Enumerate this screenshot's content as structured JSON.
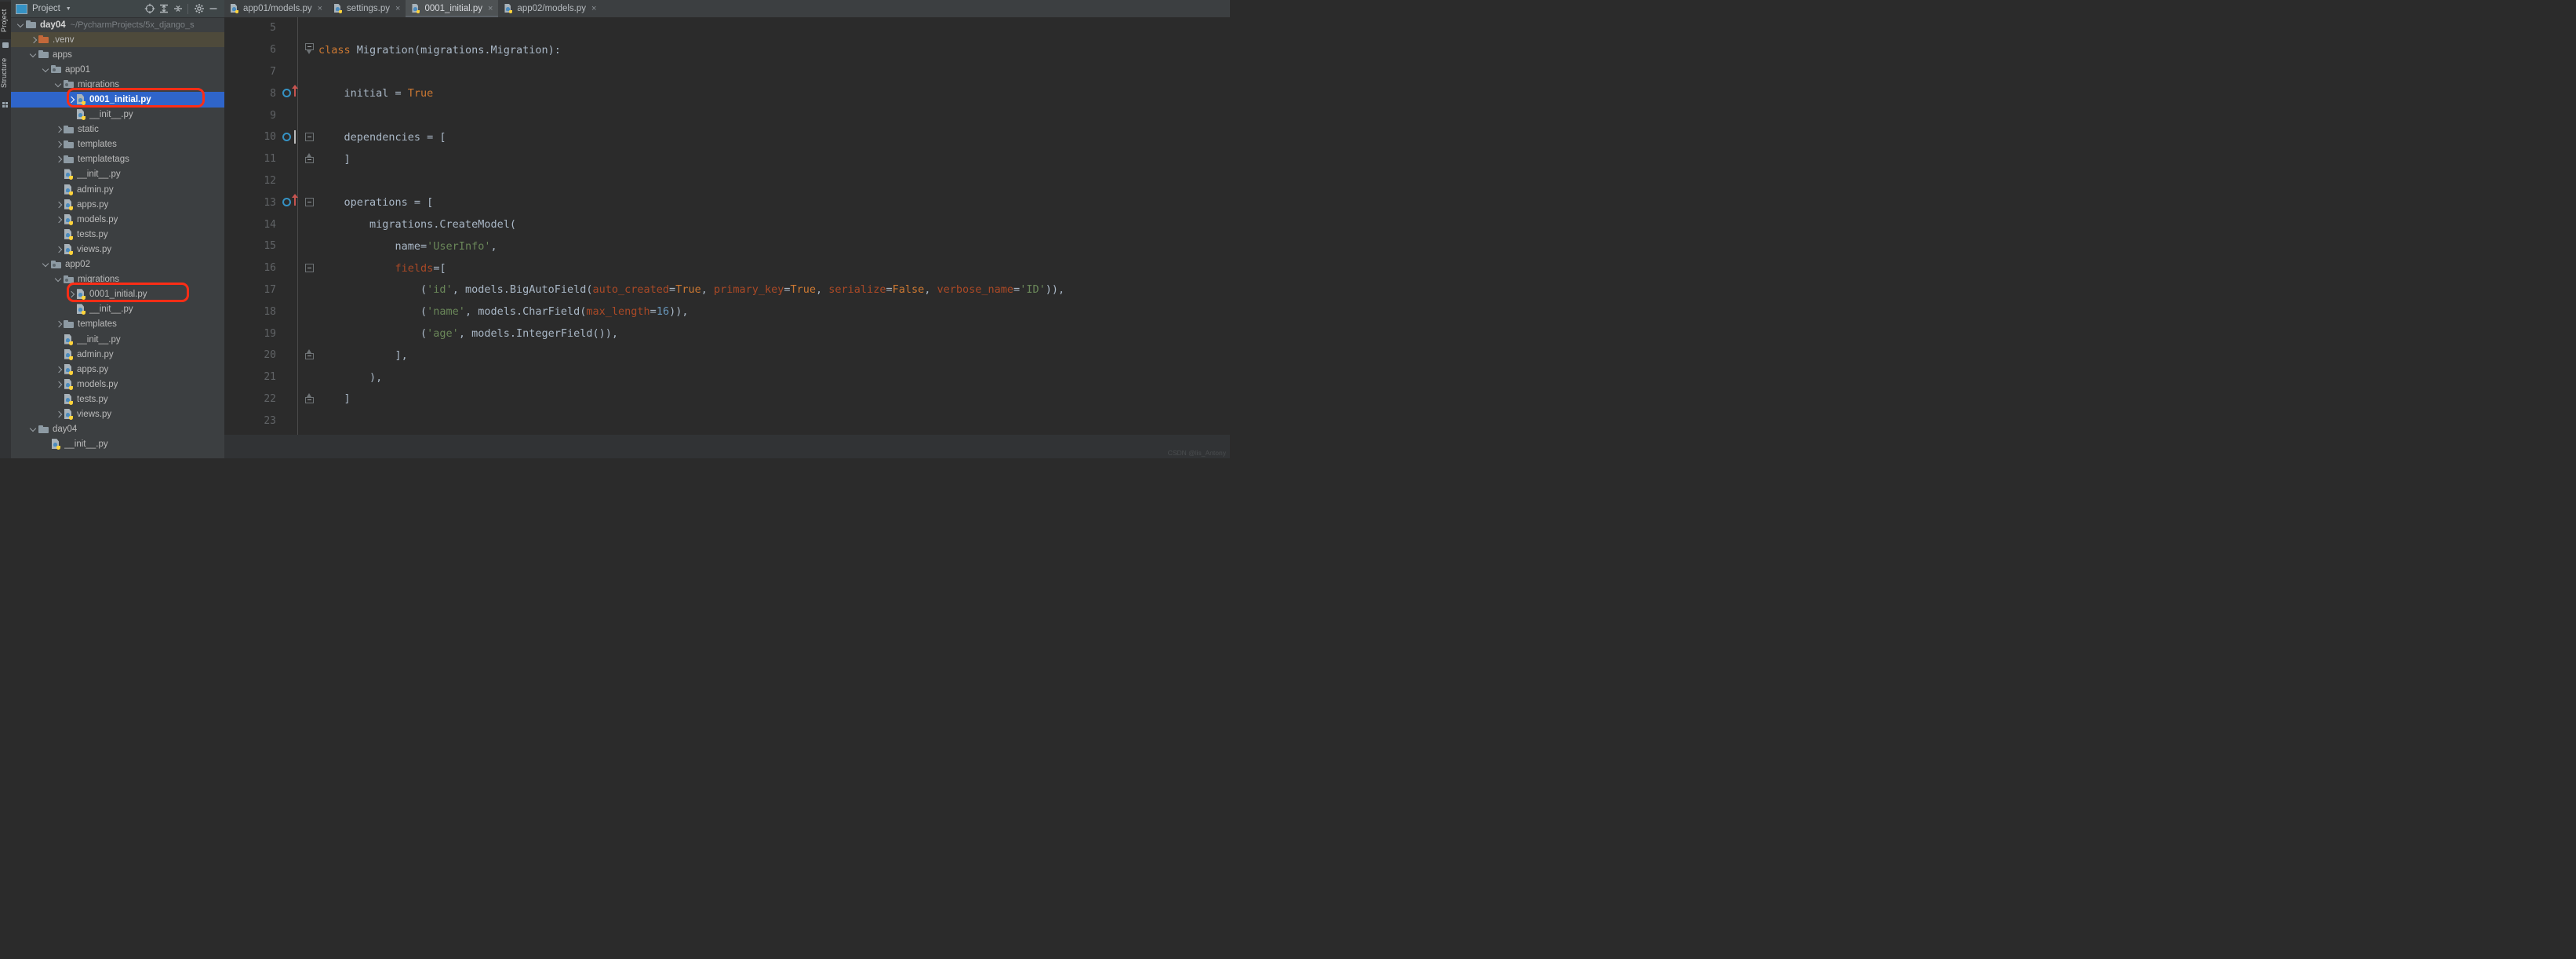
{
  "tool_strip": {
    "project_tab": "Project",
    "structure_tab": "Structure"
  },
  "panel": {
    "title": "Project",
    "icons": [
      "project-view-icon",
      "caret-down-icon",
      "locate-icon",
      "expand-all-icon",
      "collapse-all-icon",
      "gear-icon",
      "minimize-icon"
    ]
  },
  "tree": [
    {
      "indent": 0,
      "arrow": "down",
      "icon": "folder",
      "label": "day04",
      "path": "~/PycharmProjects/5x_django_s",
      "bold": true,
      "state": "normal"
    },
    {
      "indent": 1,
      "arrow": "right",
      "icon": "folder-orange",
      "label": ".venv",
      "path": "",
      "bold": false,
      "state": "venv"
    },
    {
      "indent": 1,
      "arrow": "down",
      "icon": "folder",
      "label": "apps",
      "path": "",
      "bold": false,
      "state": "normal"
    },
    {
      "indent": 2,
      "arrow": "down",
      "icon": "folder-pkg",
      "label": "app01",
      "path": "",
      "bold": false,
      "state": "normal"
    },
    {
      "indent": 3,
      "arrow": "down",
      "icon": "folder-pkg",
      "label": "migrations",
      "path": "",
      "bold": false,
      "state": "normal"
    },
    {
      "indent": 4,
      "arrow": "right",
      "icon": "python-file",
      "label": "0001_initial.py",
      "path": "",
      "bold": true,
      "state": "selected"
    },
    {
      "indent": 4,
      "arrow": "none",
      "icon": "python-file",
      "label": "__init__.py",
      "path": "",
      "bold": false,
      "state": "normal"
    },
    {
      "indent": 3,
      "arrow": "right",
      "icon": "folder",
      "label": "static",
      "path": "",
      "bold": false,
      "state": "normal"
    },
    {
      "indent": 3,
      "arrow": "right",
      "icon": "folder",
      "label": "templates",
      "path": "",
      "bold": false,
      "state": "normal"
    },
    {
      "indent": 3,
      "arrow": "right",
      "icon": "folder",
      "label": "templatetags",
      "path": "",
      "bold": false,
      "state": "normal"
    },
    {
      "indent": 3,
      "arrow": "none",
      "icon": "python-file",
      "label": "__init__.py",
      "path": "",
      "bold": false,
      "state": "normal"
    },
    {
      "indent": 3,
      "arrow": "none",
      "icon": "python-file",
      "label": "admin.py",
      "path": "",
      "bold": false,
      "state": "normal"
    },
    {
      "indent": 3,
      "arrow": "right",
      "icon": "python-file",
      "label": "apps.py",
      "path": "",
      "bold": false,
      "state": "normal"
    },
    {
      "indent": 3,
      "arrow": "right",
      "icon": "python-file",
      "label": "models.py",
      "path": "",
      "bold": false,
      "state": "normal"
    },
    {
      "indent": 3,
      "arrow": "none",
      "icon": "python-file",
      "label": "tests.py",
      "path": "",
      "bold": false,
      "state": "normal"
    },
    {
      "indent": 3,
      "arrow": "right",
      "icon": "python-file",
      "label": "views.py",
      "path": "",
      "bold": false,
      "state": "normal"
    },
    {
      "indent": 2,
      "arrow": "down",
      "icon": "folder-pkg",
      "label": "app02",
      "path": "",
      "bold": false,
      "state": "normal"
    },
    {
      "indent": 3,
      "arrow": "down",
      "icon": "folder-pkg",
      "label": "migrations",
      "path": "",
      "bold": false,
      "state": "normal"
    },
    {
      "indent": 4,
      "arrow": "right",
      "icon": "python-file",
      "label": "0001_initial.py",
      "path": "",
      "bold": false,
      "state": "normal"
    },
    {
      "indent": 4,
      "arrow": "none",
      "icon": "python-file",
      "label": "__init__.py",
      "path": "",
      "bold": false,
      "state": "normal"
    },
    {
      "indent": 3,
      "arrow": "right",
      "icon": "folder",
      "label": "templates",
      "path": "",
      "bold": false,
      "state": "normal"
    },
    {
      "indent": 3,
      "arrow": "none",
      "icon": "python-file",
      "label": "__init__.py",
      "path": "",
      "bold": false,
      "state": "normal"
    },
    {
      "indent": 3,
      "arrow": "none",
      "icon": "python-file",
      "label": "admin.py",
      "path": "",
      "bold": false,
      "state": "normal"
    },
    {
      "indent": 3,
      "arrow": "right",
      "icon": "python-file",
      "label": "apps.py",
      "path": "",
      "bold": false,
      "state": "normal"
    },
    {
      "indent": 3,
      "arrow": "right",
      "icon": "python-file",
      "label": "models.py",
      "path": "",
      "bold": false,
      "state": "normal"
    },
    {
      "indent": 3,
      "arrow": "none",
      "icon": "python-file",
      "label": "tests.py",
      "path": "",
      "bold": false,
      "state": "normal"
    },
    {
      "indent": 3,
      "arrow": "right",
      "icon": "python-file",
      "label": "views.py",
      "path": "",
      "bold": false,
      "state": "normal"
    },
    {
      "indent": 1,
      "arrow": "down",
      "icon": "folder",
      "label": "day04",
      "path": "",
      "bold": false,
      "state": "normal"
    },
    {
      "indent": 2,
      "arrow": "none",
      "icon": "python-file",
      "label": "__init__.py",
      "path": "",
      "bold": false,
      "state": "normal"
    }
  ],
  "tabs": [
    {
      "label": "app01/models.py",
      "active": false,
      "close": "×"
    },
    {
      "label": "settings.py",
      "active": false,
      "close": "×"
    },
    {
      "label": "0001_initial.py",
      "active": true,
      "close": "×"
    },
    {
      "label": "app02/models.py",
      "active": false,
      "close": "×"
    }
  ],
  "code": {
    "first_line_number": 5,
    "lines": [
      {
        "n": "5",
        "marks": [],
        "fold": "",
        "tokens": []
      },
      {
        "n": "6",
        "marks": [],
        "fold": "top",
        "tokens": [
          {
            "t": "class ",
            "c": "kw"
          },
          {
            "t": "Migration",
            "c": "cls"
          },
          {
            "t": "(migrations.Migration):",
            "c": "plain"
          }
        ],
        "indent": 0
      },
      {
        "n": "7",
        "marks": [],
        "fold": "",
        "tokens": []
      },
      {
        "n": "8",
        "marks": [
          "run",
          "arrow-up"
        ],
        "fold": "",
        "tokens": [
          {
            "t": "    initial = ",
            "c": "plain"
          },
          {
            "t": "True",
            "c": "kw"
          }
        ]
      },
      {
        "n": "9",
        "marks": [],
        "fold": "",
        "tokens": []
      },
      {
        "n": "10",
        "marks": [
          "run",
          "caret"
        ],
        "fold": "box",
        "tokens": [
          {
            "t": "    dependencies = [",
            "c": "plain"
          }
        ]
      },
      {
        "n": "11",
        "marks": [],
        "fold": "end",
        "tokens": [
          {
            "t": "    ]",
            "c": "plain"
          }
        ]
      },
      {
        "n": "12",
        "marks": [],
        "fold": "",
        "tokens": []
      },
      {
        "n": "13",
        "marks": [
          "run",
          "arrow-up"
        ],
        "fold": "box",
        "tokens": [
          {
            "t": "    operations = [",
            "c": "plain"
          }
        ]
      },
      {
        "n": "14",
        "marks": [],
        "fold": "",
        "tokens": [
          {
            "t": "        migrations.CreateModel(",
            "c": "plain"
          }
        ]
      },
      {
        "n": "15",
        "marks": [],
        "fold": "",
        "tokens": [
          {
            "t": "            name=",
            "c": "plain"
          },
          {
            "t": "'UserInfo'",
            "c": "str"
          },
          {
            "t": ",",
            "c": "plain"
          }
        ]
      },
      {
        "n": "16",
        "marks": [],
        "fold": "box",
        "tokens": [
          {
            "t": "            fields",
            "c": "kwarg"
          },
          {
            "t": "=[",
            "c": "plain"
          }
        ]
      },
      {
        "n": "17",
        "marks": [],
        "fold": "",
        "tokens": [
          {
            "t": "                (",
            "c": "plain"
          },
          {
            "t": "'id'",
            "c": "str"
          },
          {
            "t": ", models.BigAutoField(",
            "c": "plain"
          },
          {
            "t": "auto_created",
            "c": "kwarg"
          },
          {
            "t": "=",
            "c": "plain"
          },
          {
            "t": "True",
            "c": "kw"
          },
          {
            "t": ", ",
            "c": "plain"
          },
          {
            "t": "primary_key",
            "c": "kwarg"
          },
          {
            "t": "=",
            "c": "plain"
          },
          {
            "t": "True",
            "c": "kw"
          },
          {
            "t": ", ",
            "c": "plain"
          },
          {
            "t": "serialize",
            "c": "kwarg"
          },
          {
            "t": "=",
            "c": "plain"
          },
          {
            "t": "False",
            "c": "kw"
          },
          {
            "t": ", ",
            "c": "plain"
          },
          {
            "t": "verbose_name",
            "c": "kwarg"
          },
          {
            "t": "=",
            "c": "plain"
          },
          {
            "t": "'ID'",
            "c": "str"
          },
          {
            "t": ")),",
            "c": "plain"
          }
        ]
      },
      {
        "n": "18",
        "marks": [],
        "fold": "",
        "tokens": [
          {
            "t": "                (",
            "c": "plain"
          },
          {
            "t": "'name'",
            "c": "str"
          },
          {
            "t": ", models.CharField(",
            "c": "plain"
          },
          {
            "t": "max_length",
            "c": "kwarg"
          },
          {
            "t": "=",
            "c": "plain"
          },
          {
            "t": "16",
            "c": "num"
          },
          {
            "t": ")),",
            "c": "plain"
          }
        ]
      },
      {
        "n": "19",
        "marks": [],
        "fold": "",
        "tokens": [
          {
            "t": "                (",
            "c": "plain"
          },
          {
            "t": "'age'",
            "c": "str"
          },
          {
            "t": ", models.IntegerField()),",
            "c": "plain"
          }
        ]
      },
      {
        "n": "20",
        "marks": [],
        "fold": "end",
        "tokens": [
          {
            "t": "            ],",
            "c": "plain"
          }
        ]
      },
      {
        "n": "21",
        "marks": [],
        "fold": "",
        "tokens": [
          {
            "t": "        ),",
            "c": "plain"
          }
        ]
      },
      {
        "n": "22",
        "marks": [],
        "fold": "end",
        "tokens": [
          {
            "t": "    ]",
            "c": "plain"
          }
        ]
      },
      {
        "n": "23",
        "marks": [],
        "fold": "",
        "tokens": []
      }
    ]
  },
  "watermark": "CSDN @lis_Antony",
  "colors": {
    "selection_blue": "#2f65ca",
    "annotation_red": "#fc2d16",
    "keyword_orange": "#cc7832",
    "string_green": "#6a8759",
    "number_blue": "#6897bb",
    "kwarg_rust": "#aa4926",
    "editor_bg": "#2b2b2b",
    "panel_bg": "#3c3f41"
  }
}
